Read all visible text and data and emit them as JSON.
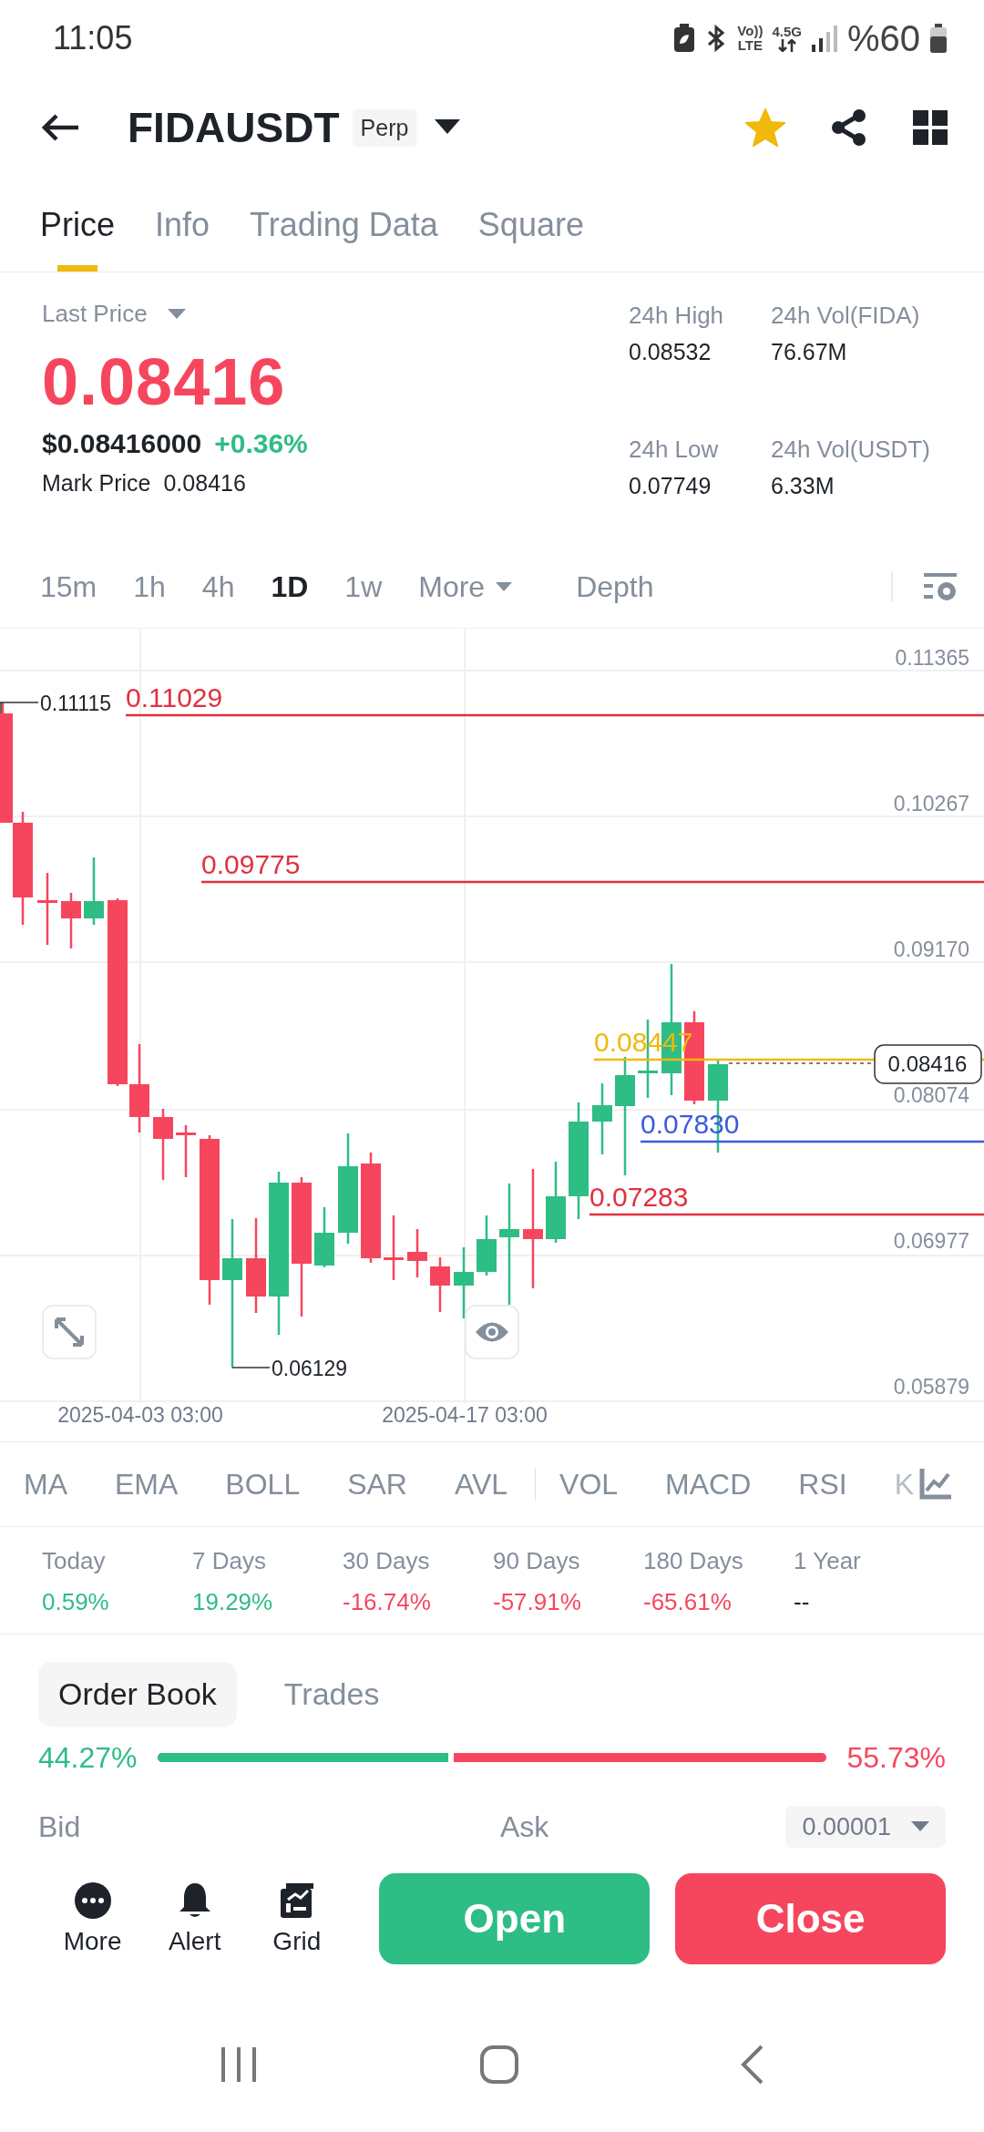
{
  "status_bar": {
    "time": "11:05",
    "volte": "Vo))",
    "lte": "LTE",
    "network": "4.5G",
    "battery": "%60"
  },
  "header": {
    "symbol": "FIDAUSDT",
    "badge": "Perp",
    "favorite": true
  },
  "tabs": [
    {
      "label": "Price",
      "selected": true
    },
    {
      "label": "Info",
      "selected": false
    },
    {
      "label": "Trading Data",
      "selected": false
    },
    {
      "label": "Square",
      "selected": false
    }
  ],
  "price": {
    "label": "Last Price",
    "last": "0.08416",
    "usd": "$0.08416000",
    "change": "+0.36%",
    "mark_label": "Mark Price",
    "mark": "0.08416"
  },
  "stats": [
    {
      "label": "24h High",
      "value": "0.08532"
    },
    {
      "label": "24h Vol(FIDA)",
      "value": "76.67M"
    },
    {
      "label": "24h Low",
      "value": "0.07749"
    },
    {
      "label": "24h Vol(USDT)",
      "value": "6.33M"
    }
  ],
  "timeframes": [
    {
      "label": "15m",
      "selected": false,
      "kind": "interval"
    },
    {
      "label": "1h",
      "selected": false,
      "kind": "interval"
    },
    {
      "label": "4h",
      "selected": false,
      "kind": "interval"
    },
    {
      "label": "1D",
      "selected": true,
      "kind": "interval"
    },
    {
      "label": "1w",
      "selected": false,
      "kind": "interval"
    },
    {
      "label": "More",
      "selected": false,
      "kind": "dropdown"
    },
    {
      "label": "Depth",
      "selected": false,
      "kind": "view"
    }
  ],
  "chart": {
    "y_labels": [
      "0.11365",
      "0.10267",
      "0.09170",
      "0.08074",
      "0.06977",
      "0.05879"
    ],
    "price_lines": [
      {
        "label": "0.11029",
        "color": "#e0313f"
      },
      {
        "label": "0.09775",
        "color": "#e0313f"
      },
      {
        "label": "0.08447",
        "color": "#f0b90b"
      },
      {
        "label": "0.07830",
        "color": "#3d5ae0"
      },
      {
        "label": "0.07283",
        "color": "#e0313f"
      }
    ],
    "high_marker": "0.11115",
    "low_marker": "0.06129",
    "current_price": "0.08416",
    "dates": [
      "2025-04-03 03:00",
      "2025-04-17 03:00"
    ]
  },
  "indicators": {
    "main": [
      "MA",
      "EMA",
      "BOLL",
      "SAR",
      "AVL"
    ],
    "sub": [
      "VOL",
      "MACD",
      "RSI",
      "K"
    ]
  },
  "performance": [
    {
      "label": "Today",
      "value": "0.59%",
      "color": "#2ebd85"
    },
    {
      "label": "7 Days",
      "value": "19.29%",
      "color": "#2ebd85"
    },
    {
      "label": "30 Days",
      "value": "-16.74%",
      "color": "#f6465d"
    },
    {
      "label": "90 Days",
      "value": "-57.91%",
      "color": "#f6465d"
    },
    {
      "label": "180 Days",
      "value": "-65.61%",
      "color": "#f6465d"
    },
    {
      "label": "1 Year",
      "value": "--",
      "color": "#1e2329"
    }
  ],
  "book_tabs": [
    {
      "label": "Order Book",
      "selected": true
    },
    {
      "label": "Trades",
      "selected": false
    }
  ],
  "ratio": {
    "bid": "44.27%",
    "ask": "55.73%",
    "level": 0.4427
  },
  "book_header": {
    "bid": "Bid",
    "ask": "Ask",
    "precision": "0.00001"
  },
  "actions": [
    {
      "label": "More",
      "kind": "more"
    },
    {
      "label": "Alert",
      "kind": "alert"
    },
    {
      "label": "Grid",
      "kind": "grid"
    }
  ],
  "buttons": {
    "open": "Open",
    "close": "Close"
  }
}
